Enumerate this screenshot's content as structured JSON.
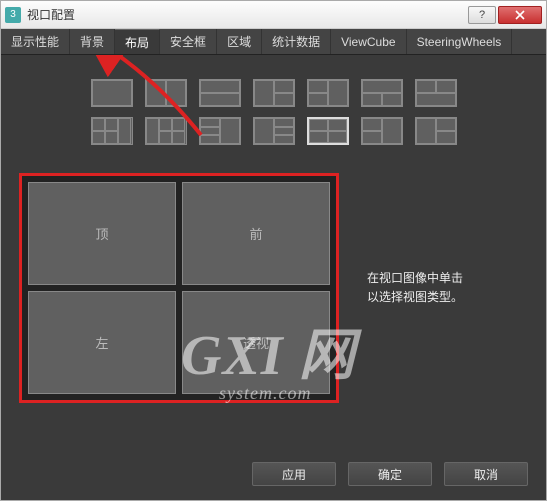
{
  "window": {
    "title": "视口配置"
  },
  "tabs": [
    "显示性能",
    "背景",
    "布局",
    "安全框",
    "区域",
    "统计数据",
    "ViewCube",
    "SteeringWheels"
  ],
  "activeTabIndex": 2,
  "viewports": {
    "tl": "顶",
    "tr": "前",
    "bl": "左",
    "br": "透视"
  },
  "hint": {
    "line1": "在视口图像中单击",
    "line2": "以选择视图类型。"
  },
  "buttons": {
    "apply": "应用",
    "ok": "确定",
    "cancel": "取消"
  },
  "watermark": {
    "big": "GXI 网",
    "small": "system.com"
  }
}
